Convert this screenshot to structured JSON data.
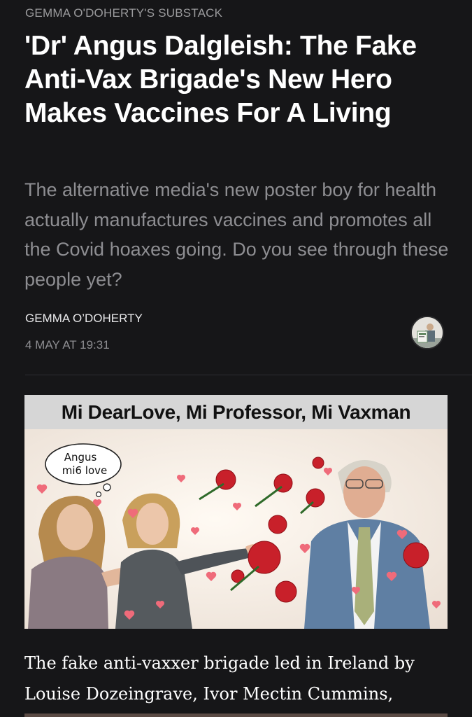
{
  "publication": {
    "name": "GEMMA O'DOHERTY'S SUBSTACK"
  },
  "article": {
    "title": "'Dr' Angus Dalgleish: The Fake Anti-Vax Brigade's New Hero Makes Vaccines For A Living",
    "subtitle": "The alternative media's new poster boy for health actually manufactures vaccines and promotes all the Covid hoaxes going. Do you see through these people yet?",
    "author": "GEMMA O’DOHERTY",
    "date": "4 MAY AT 19:31",
    "body_start": "The fake anti-vaxxer brigade led in Ireland by Louise Dozeingrave, Ivor Mectin Cummins,"
  },
  "image": {
    "caption": "Mi DearLove, Mi Professor, Mi Vaxman",
    "thought_bubble_line1": "Angus",
    "thought_bubble_line2": "mi6 love"
  },
  "colors": {
    "background": "#161618",
    "muted_text": "#8e8e92",
    "rose": "#c8202a"
  }
}
